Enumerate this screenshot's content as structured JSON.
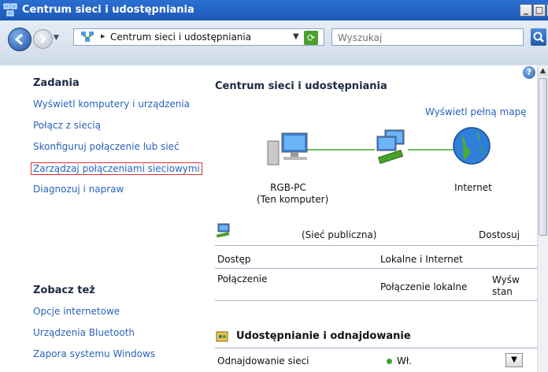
{
  "window": {
    "title": "Centrum sieci i udostępniania",
    "icon": "network-center-icon",
    "buttons": {
      "minimize": "_",
      "maximize": "□",
      "close": "X"
    }
  },
  "address_bar": {
    "path_text": "Centrum sieci i udostępniania",
    "search_placeholder": "Wyszukaj"
  },
  "sidebar": {
    "tasks_header": "Zadania",
    "tasks": [
      "Wyświetl komputery i urządzenia",
      "Połącz z siecią",
      "Skonfiguruj połączenie lub sieć",
      "Zarządzaj połączeniami sieciowymi",
      "Diagnozuj i napraw"
    ],
    "see_also_header": "Zobacz też",
    "see_also": [
      "Opcje internetowe",
      "Urządzenia Bluetooth",
      "Zapora systemu Windows"
    ]
  },
  "main": {
    "title": "Centrum sieci i udostępniania",
    "full_map_link": "Wyświetl pełną mapę",
    "map": {
      "pc_name": "RGB-PC",
      "pc_sub": "(Ten komputer)",
      "internet": "Internet"
    },
    "network": {
      "type": "(Sieć publiczna)",
      "customize_link": "Dostosuj",
      "rows": [
        {
          "label": "Dostęp",
          "value": "Lokalne i Internet"
        },
        {
          "label": "Połączenie",
          "value": "Połączenie lokalne",
          "link_line1": "Wyśw",
          "link_line2": "stan"
        }
      ]
    },
    "sharing": {
      "header": "Udostępnianie i odnajdowanie",
      "rows": [
        {
          "label": "Odnajdowanie sieci",
          "value": "Wł."
        }
      ]
    }
  },
  "colors": {
    "title_bar": "#1d58b8",
    "link": "#2a62b9",
    "highlight_border": "#d9302b",
    "connection_line": "#6ec25d",
    "status_on": "#3aa32c"
  }
}
